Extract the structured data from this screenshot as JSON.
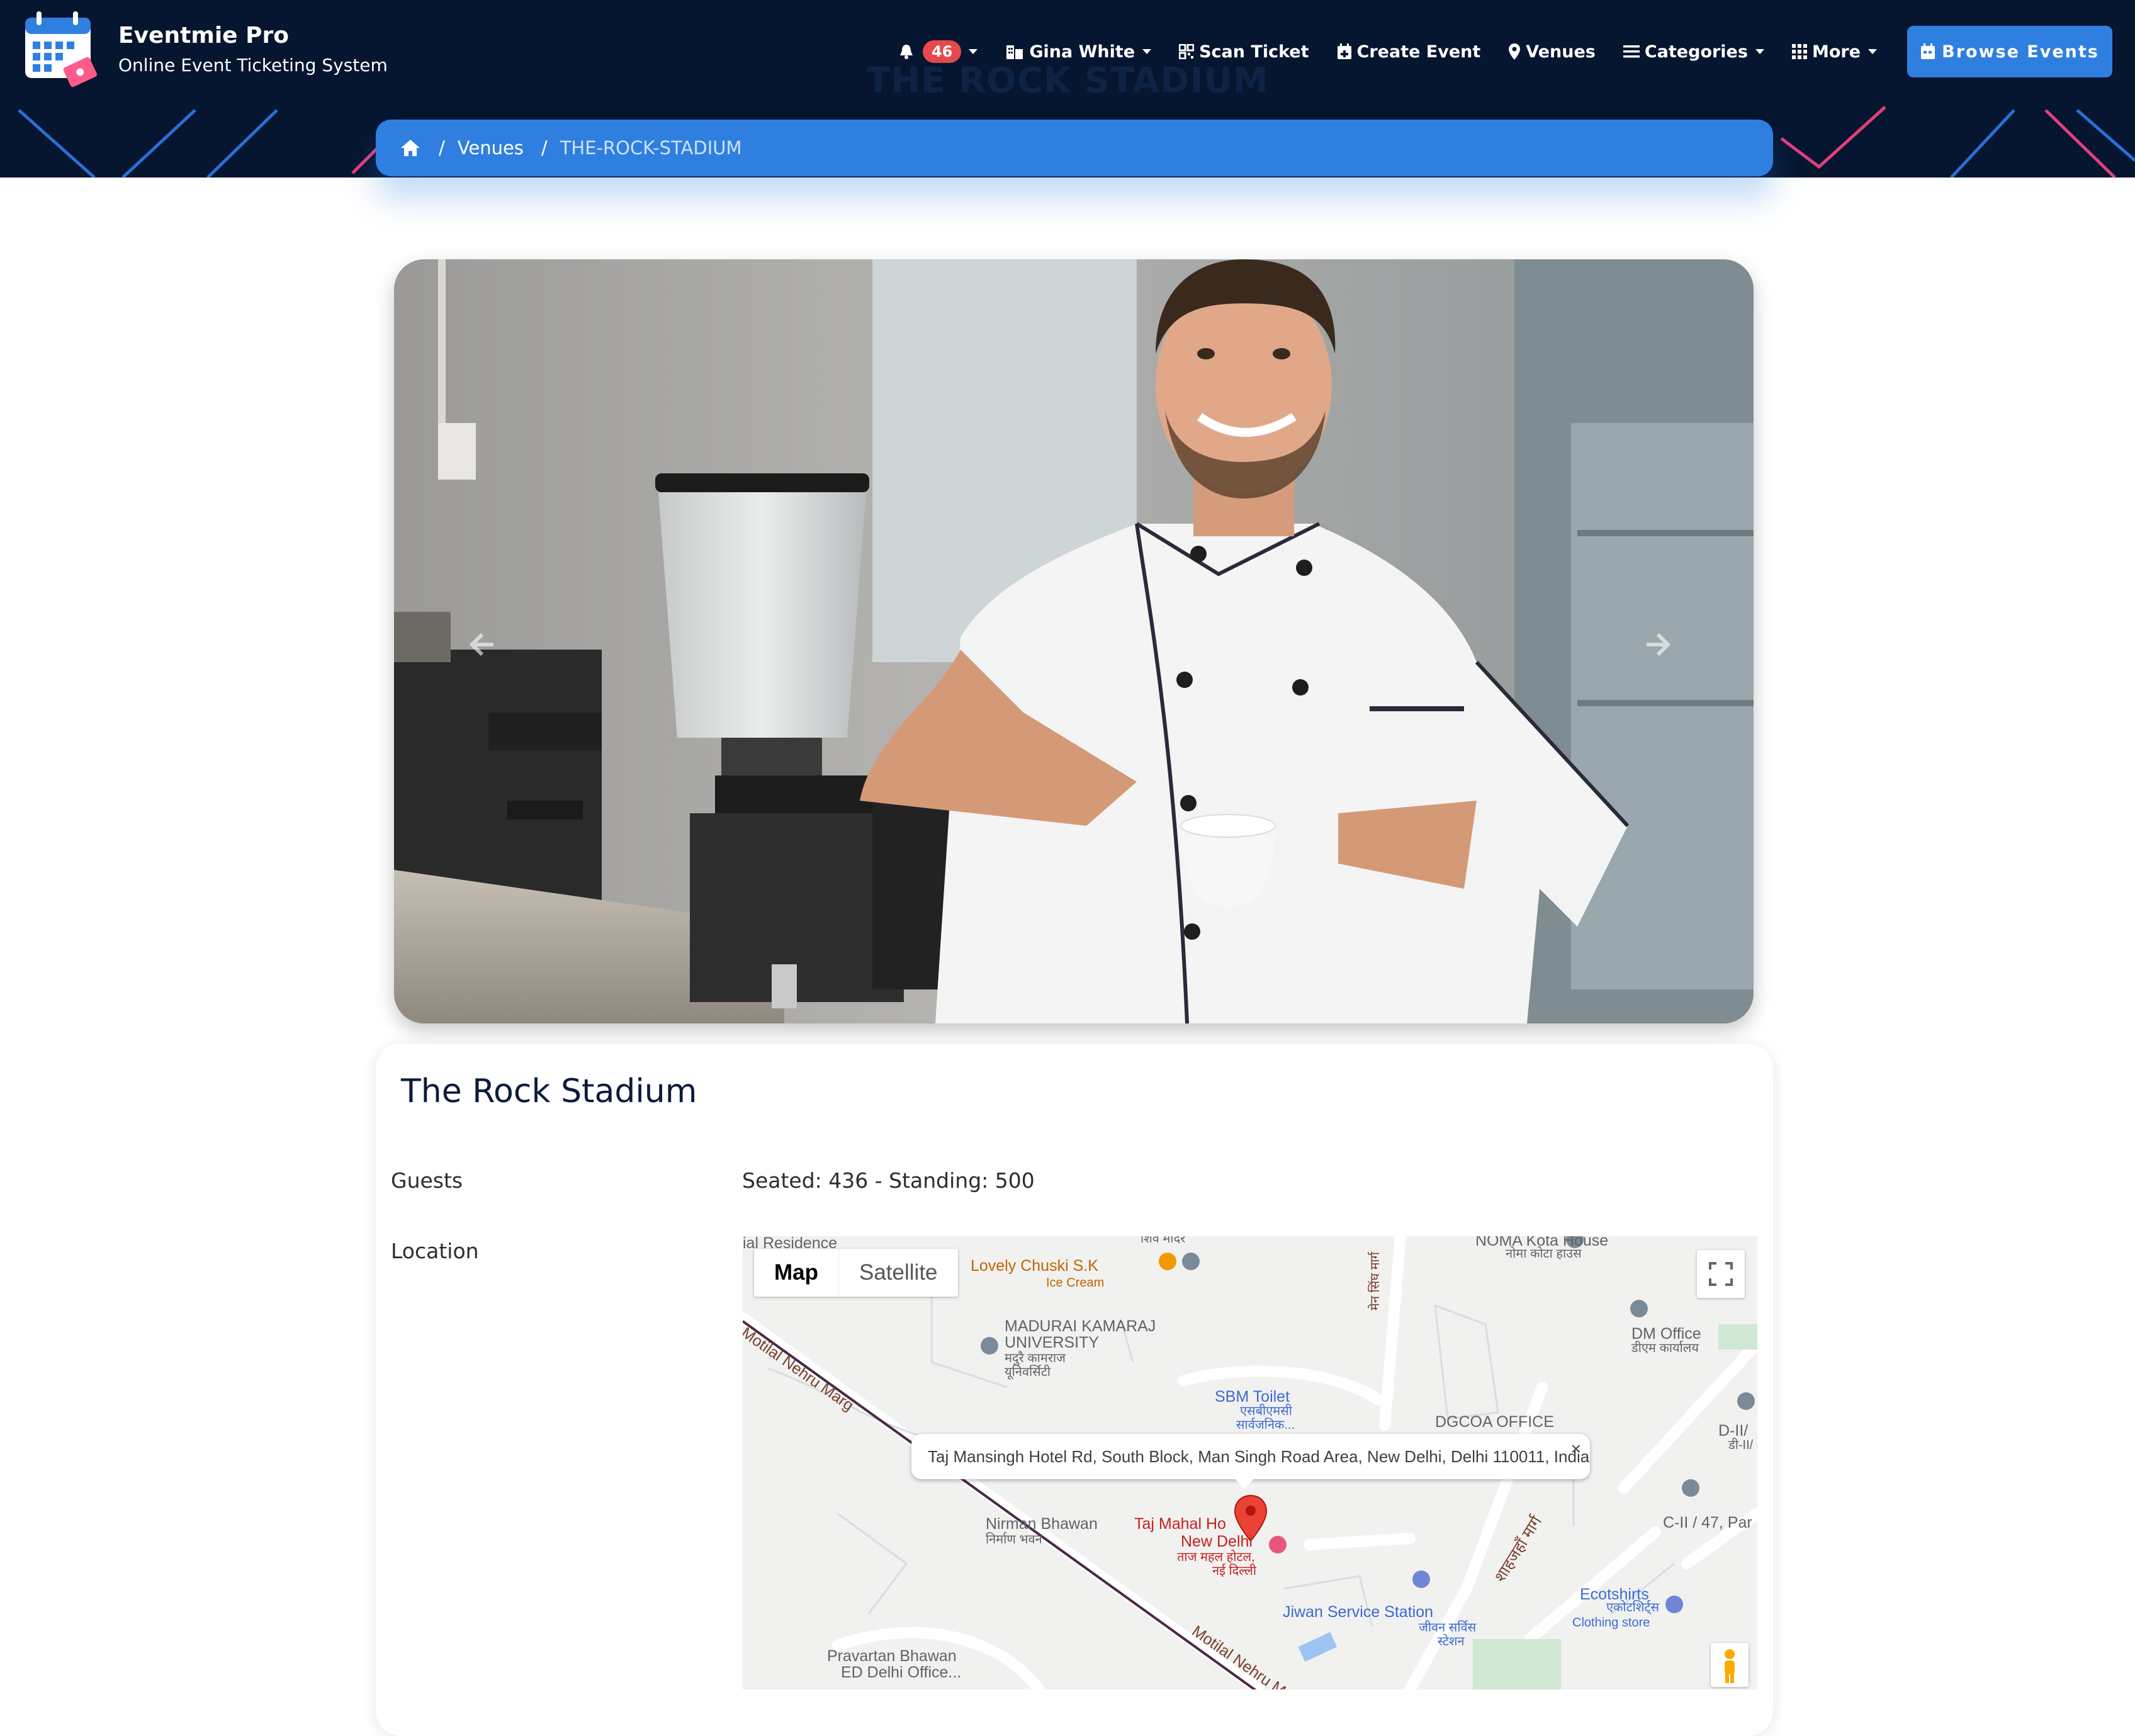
{
  "brand": {
    "name": "Eventmie Pro",
    "tagline": "Online Event Ticketing System"
  },
  "header": {
    "ghost_title": "THE ROCK STADIUM"
  },
  "nav": {
    "notifications_count": "46",
    "user_name": "Gina White",
    "scan_ticket": "Scan Ticket",
    "create_event": "Create Event",
    "venues": "Venues",
    "categories": "Categories",
    "more": "More",
    "browse_events": "Browse Events"
  },
  "breadcrumb": {
    "sep": "/",
    "items": [
      "Venues",
      "THE-ROCK-STADIUM"
    ]
  },
  "carousel": {
    "slide_count": 7,
    "active_index": 6
  },
  "venue": {
    "title": "The Rock Stadium",
    "guests_label": "Guests",
    "guests_value": "Seated: 436 - Standing: 500",
    "location_label": "Location"
  },
  "map": {
    "type_map": "Map",
    "type_satellite": "Satellite",
    "address": "Taj Mansingh Hotel Rd, South Block, Man Singh Road Area, New Delhi, Delhi 110011, India",
    "close": "×",
    "labels": {
      "residence": "ial Residence",
      "mandir": "शिव मंदिर",
      "noma": "NOMA Kota House",
      "noma_hi": "नोमा कोटा हाउस",
      "chuski": "Lovely Chuski S.K",
      "chuski_sub": "Ice Cream",
      "university": "MADURAI KAMARAJ",
      "university2": "UNIVERSITY",
      "university_hi": "मदुरै कामराज",
      "university_hi2": "यूनिवर्सिटी",
      "road_hi": "मेन सिंघ मार्ग",
      "dm_office": "DM Office",
      "dm_office_hi": "डीएम कार्यालय",
      "motilal": "Motilal Nehru Marg",
      "sbm": "SBM Toilet",
      "sbm_hi": "एसबीएमसी",
      "sbm_hi2": "सार्वजनिक...",
      "dgcoa": "DGCOA OFFICE",
      "d2": "D-II/",
      "d2_hi": "डी-II/",
      "nirman": "Nirman Bhawan",
      "nirman_hi": "निर्माण भवन",
      "taj": "Taj Mahal Ho",
      "taj2": "New Delhi",
      "taj_hi": "ताज महल होटल,",
      "taj_hi2": "नई दिल्ली",
      "shahjahan": "शाहजहाँ मार्ग",
      "c2": "C-II / 47, Par",
      "jiwan": "Jiwan Service Station",
      "jiwan_hi": "जीवन सर्विस",
      "jiwan_hi2": "स्टेशन",
      "ecoshirts": "Ecotshirts",
      "ecoshirts_hi": "एकोटशिर्ट्स",
      "ecoshirts_sub": "Clothing store",
      "pravartan": "Pravartan Bhawan",
      "pravartan2": "ED Delhi Office...",
      "motilal2": "Motilal Nehru Ma"
    }
  },
  "colors": {
    "header_bg": "#061530",
    "accent": "#2f7fe0",
    "badge": "#e5484d",
    "pin": "#ea4335"
  }
}
